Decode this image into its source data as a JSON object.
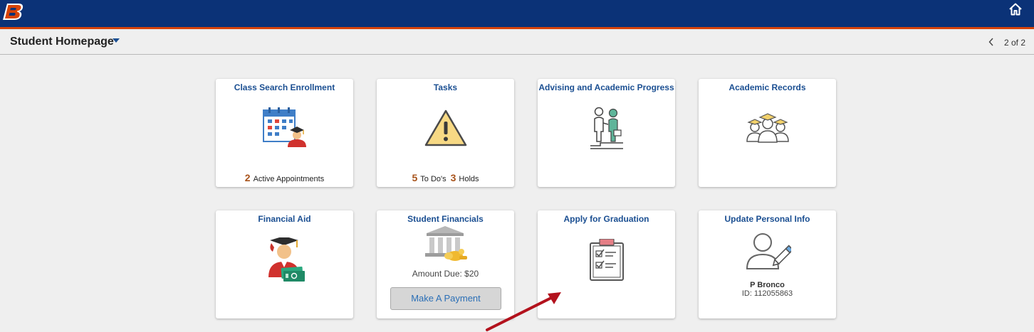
{
  "header": {
    "logo_alt": "B",
    "home_icon": "home-icon",
    "brand_color": "#0b3277",
    "accent_color": "#d64309"
  },
  "subheader": {
    "title": "Student Homepage",
    "pager": "2 of 2"
  },
  "tiles": [
    {
      "title": "Class Search Enrollment",
      "icon": "calendar-student-icon",
      "count": "2",
      "label": "Active Appointments"
    },
    {
      "title": "Tasks",
      "icon": "warning-icon",
      "count1": "5",
      "label1": "To Do's",
      "count2": "3",
      "label2": "Holds"
    },
    {
      "title": "Advising and Academic Progress",
      "icon": "advising-icon"
    },
    {
      "title": "Academic Records",
      "icon": "graduates-icon"
    },
    {
      "title": "Financial Aid",
      "icon": "graduate-money-icon"
    },
    {
      "title": "Student Financials",
      "icon": "bank-icon",
      "amount_text": "Amount Due: $20",
      "button": "Make A Payment"
    },
    {
      "title": "Apply for Graduation",
      "icon": "clipboard-checklist-icon"
    },
    {
      "title": "Update Personal Info",
      "icon": "person-edit-icon",
      "name": "P Bronco",
      "id_text": "ID: 112055863"
    }
  ]
}
